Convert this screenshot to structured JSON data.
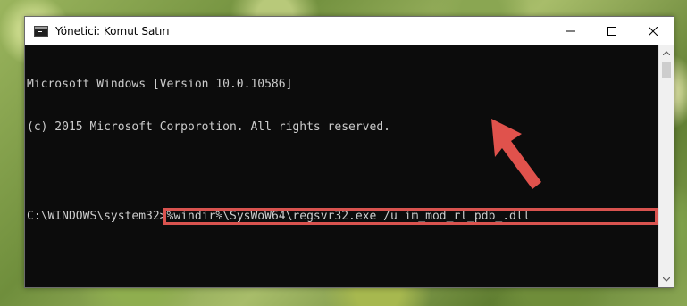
{
  "window": {
    "title": "Yönetici: Komut Satırı"
  },
  "console": {
    "lines": [
      "Microsoft Windows [Version 10.0.10586]",
      "(c) 2015 Microsoft Corporotion. All rights reserved."
    ],
    "prompt": "C:\\WINDOWS\\system32>",
    "command": "%windir%\\SysWoW64\\regsvr32.exe /u im_mod_rl_pdb_.dll"
  },
  "colors": {
    "highlight": "#d9534f",
    "arrow": "#e0524c",
    "console_bg": "#0c0c0c",
    "console_fg": "#cccccc"
  },
  "icons": {
    "app": "cmd-icon",
    "minimize": "minimize-icon",
    "maximize": "maximize-icon",
    "close": "close-icon",
    "annotation": "red-arrow-icon"
  }
}
